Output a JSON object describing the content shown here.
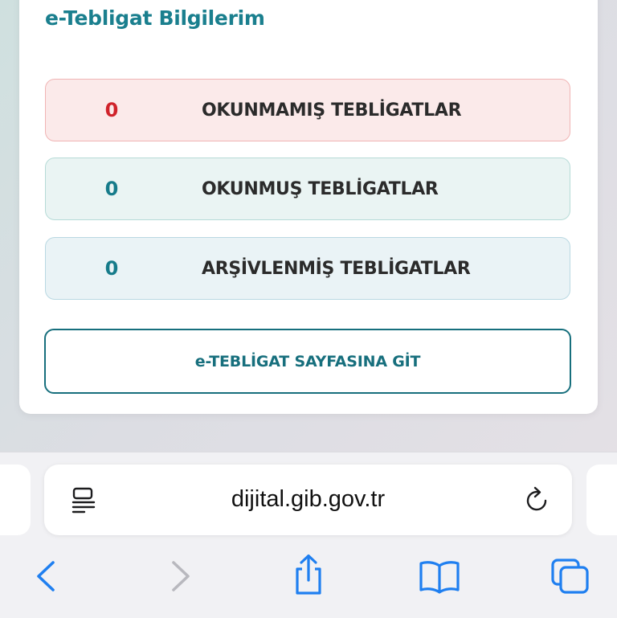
{
  "card": {
    "title": "e-Tebligat Bilgilerim",
    "stats": [
      {
        "count": "0",
        "label": "OKUNMAMIŞ TEBLİGATLAR"
      },
      {
        "count": "0",
        "label": "OKUNMUŞ TEBLİGATLAR"
      },
      {
        "count": "0",
        "label": "ARŞİVLENMİŞ TEBLİGATLAR"
      }
    ],
    "goto_label": "e-TEBLİGAT SAYFASINA GİT"
  },
  "browser": {
    "url": "dijital.gib.gov.tr",
    "icons": {
      "reader": "reader-mode-icon",
      "reload": "reload-icon",
      "back": "chevron-left-icon",
      "forward": "chevron-right-icon",
      "share": "share-icon",
      "bookmarks": "book-icon",
      "tabs": "tabs-icon"
    }
  },
  "colors": {
    "accent": "#1a7f8e",
    "unread": "#d0232b",
    "ios_blue": "#1f7ff0",
    "disabled": "#b8b8be"
  }
}
